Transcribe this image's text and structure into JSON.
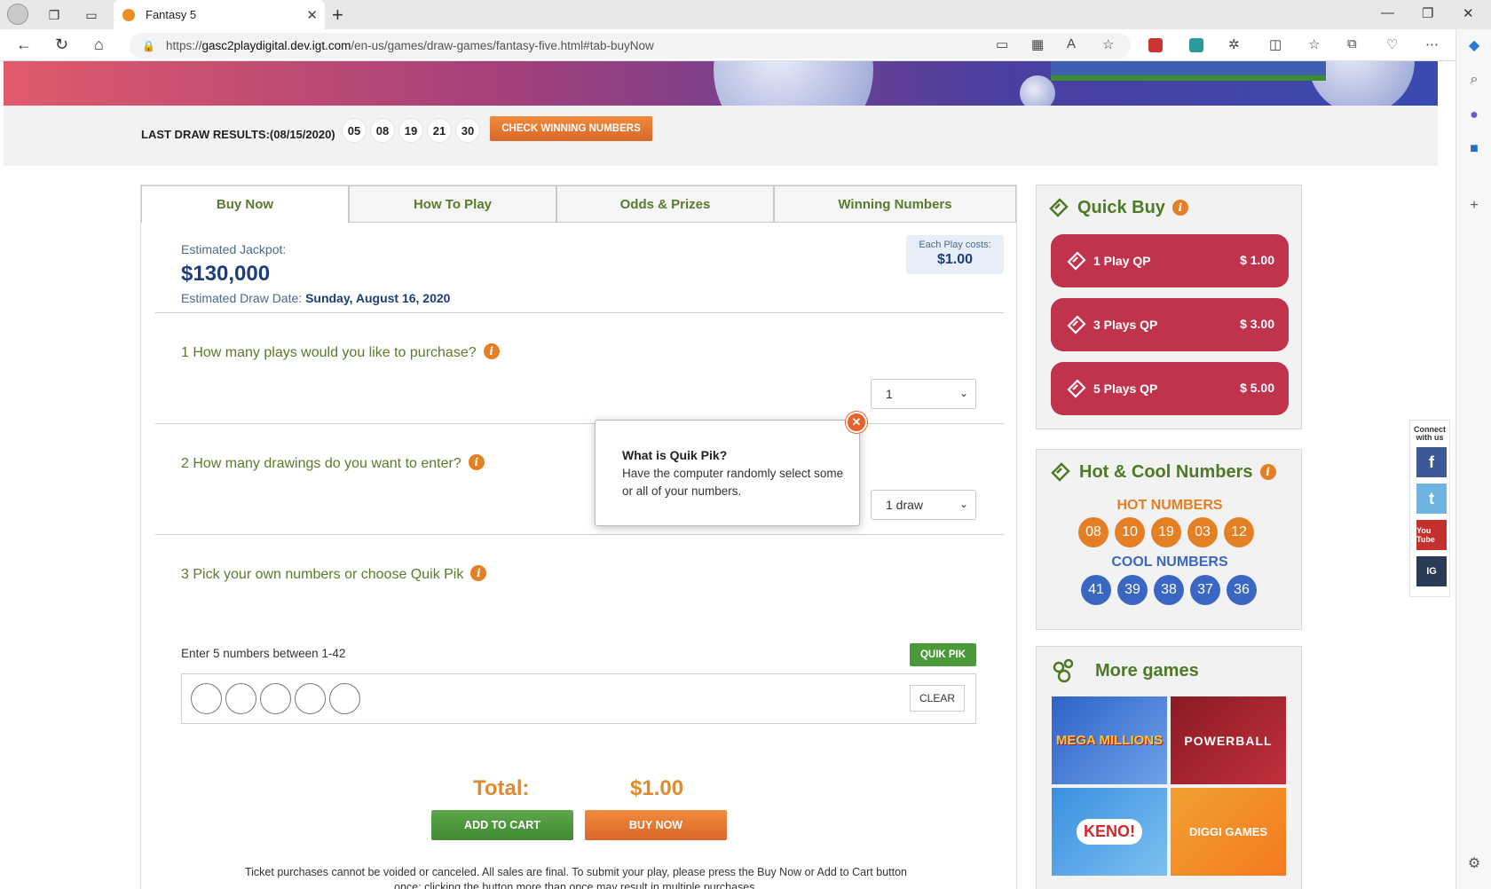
{
  "browser": {
    "tab_title": "Fantasy 5",
    "url_prefix": "https://",
    "url_host": "gasc2playdigital.dev.igt.com",
    "url_path": "/en-us/games/draw-games/fantasy-five.html#tab-buyNow"
  },
  "draw": {
    "label": "LAST DRAW RESULTS:(08/15/2020)",
    "numbers": [
      "05",
      "08",
      "19",
      "21",
      "30"
    ],
    "check_button": "CHECK WINNING NUMBERS"
  },
  "tabs": [
    "Buy Now",
    "How To Play",
    "Odds & Prizes",
    "Winning Numbers"
  ],
  "jackpot": {
    "label": "Estimated Jackpot:",
    "amount": "$130,000",
    "date_label": "Estimated Draw Date:",
    "date_value": "Sunday, August 16, 2020",
    "cost_label": "Each Play costs:",
    "cost_value": "$1.00"
  },
  "steps": {
    "q1": "1 How many plays would you like to purchase?",
    "q1_value": "1",
    "q2": "2 How many drawings do you want to enter?",
    "q2_value": "1 draw",
    "q3": "3 Pick your own numbers or choose Quik Pik",
    "hint": "Enter 5 numbers between 1-42",
    "quikpik_button": "QUIK PIK",
    "clear_button": "CLEAR"
  },
  "total": {
    "label": "Total:",
    "value": "$1.00",
    "add_to_cart": "ADD TO CART",
    "buy_now": "BUY NOW"
  },
  "disclaimer": "Ticket purchases cannot be voided or canceled. All sales are final. To submit your play, please press the Buy Now or Add to Cart button once; clicking the button more than once may result in multiple purchases.",
  "popover": {
    "title": "What is Quik Pik?",
    "body": "Have the computer randomly select some or all of your numbers.",
    "close_icon": "close-icon"
  },
  "quick_buy": {
    "title": "Quick Buy",
    "buttons": [
      {
        "label": "1 Play QP",
        "price": "$ 1.00"
      },
      {
        "label": "3 Plays QP",
        "price": "$ 3.00"
      },
      {
        "label": "5 Plays QP",
        "price": "$ 5.00"
      }
    ]
  },
  "hot_cool": {
    "title": "Hot & Cool Numbers",
    "hot_label": "HOT NUMBERS",
    "hot": [
      "08",
      "10",
      "19",
      "03",
      "12"
    ],
    "cool_label": "COOL NUMBERS",
    "cool": [
      "41",
      "39",
      "38",
      "37",
      "36"
    ]
  },
  "more_games": {
    "title": "More games",
    "games": [
      "MEGA MILLIONS",
      "POWERBALL",
      "KENO!",
      "DIGGI GAMES"
    ]
  },
  "social": {
    "caption": "Connect with us",
    "networks": [
      "f",
      "t",
      "You Tube",
      "IG"
    ]
  },
  "colors": {
    "green": "#5b7a2a",
    "orange": "#e08a2e",
    "navy": "#1f3d7a",
    "quick_buy_red": "#c1334d",
    "hot": "#e57f24",
    "cool": "#3a66c4"
  }
}
